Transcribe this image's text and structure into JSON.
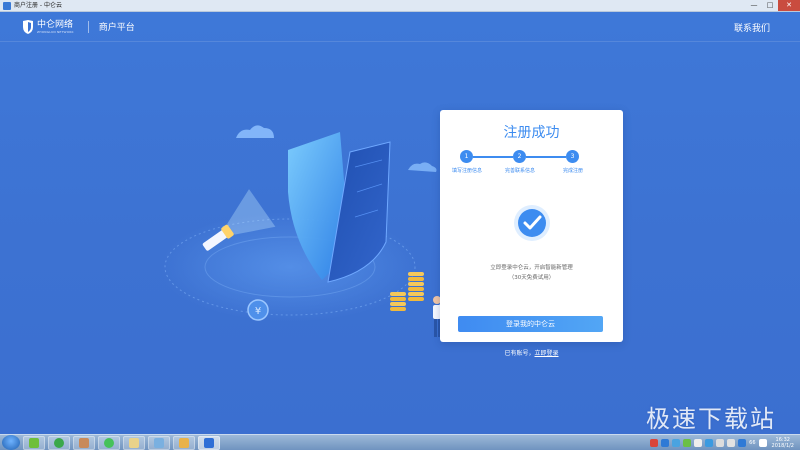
{
  "window": {
    "title": "商户注册 - 中仑云",
    "controls": {
      "minimize": "—",
      "maximize": "□",
      "close": "✕"
    }
  },
  "header": {
    "logo_text": "中仑网络",
    "logo_sub": "ZHONGLUN NETWORK",
    "platform": "商户平台",
    "contact": "联系我们"
  },
  "card": {
    "title": "注册成功",
    "steps": [
      {
        "num": "1",
        "label": "填写注册信息"
      },
      {
        "num": "2",
        "label": "完善联系信息"
      },
      {
        "num": "3",
        "label": "完成注册"
      }
    ],
    "message_line1": "立即登录中仑云，开启智能新管理",
    "message_line2": "（30天免费试用）",
    "button": "登录我的中仑云"
  },
  "below": {
    "text": "已有账号，",
    "link": "立即登录"
  },
  "watermark": "极速下载站",
  "taskbar": {
    "time": "16:32",
    "date": "2018/1/2",
    "tray_badge": "66"
  },
  "colors": {
    "accent": "#3d8cf0",
    "background": "#3b73d4"
  }
}
